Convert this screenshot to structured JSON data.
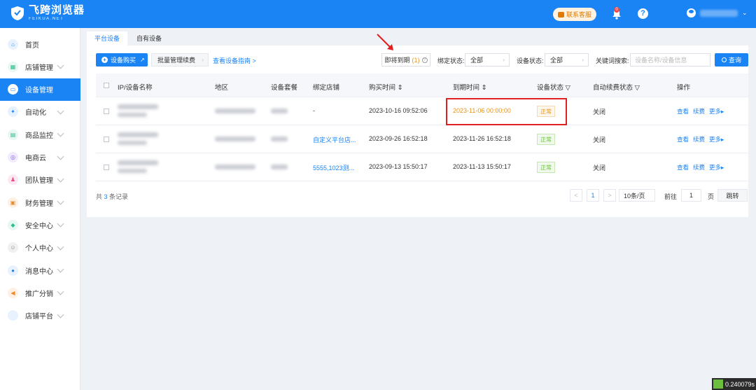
{
  "app": {
    "name_cn": "飞跨浏览器",
    "name_en": "FEIKUA.NET"
  },
  "topbar": {
    "contact": "联系客服",
    "notif_count": "0",
    "help": "?"
  },
  "sidebar": {
    "items": [
      {
        "label": "首页",
        "icon": "home-icon",
        "color": "#1b84f5",
        "bg": "#e8f2fe",
        "glyph": "⌂"
      },
      {
        "label": "店铺管理",
        "icon": "store-icon",
        "color": "#2dbf8a",
        "bg": "#e6f8f1",
        "glyph": "▦"
      },
      {
        "label": "设备管理",
        "icon": "device-icon",
        "color": "#1b84f5",
        "bg": "#ffffff",
        "glyph": "▭"
      },
      {
        "label": "自动化",
        "icon": "automation-icon",
        "color": "#1b84f5",
        "bg": "#e8f2fe",
        "glyph": "✦"
      },
      {
        "label": "商品监控",
        "icon": "monitor-icon",
        "color": "#2dbf8a",
        "bg": "#e6f8f1",
        "glyph": "▤"
      },
      {
        "label": "电商云",
        "icon": "cloud-icon",
        "color": "#8a5cf5",
        "bg": "#f0eafe",
        "glyph": "◎"
      },
      {
        "label": "团队管理",
        "icon": "team-icon",
        "color": "#e84a8a",
        "bg": "#fde9f1",
        "glyph": "♟"
      },
      {
        "label": "财务管理",
        "icon": "finance-icon",
        "color": "#f08a24",
        "bg": "#fef1e3",
        "glyph": "▣"
      },
      {
        "label": "安全中心",
        "icon": "shield-icon",
        "color": "#2dbf8a",
        "bg": "#e6f8f1",
        "glyph": "◆"
      },
      {
        "label": "个人中心",
        "icon": "user-icon",
        "color": "#888888",
        "bg": "#f0f0f0",
        "glyph": "☺"
      },
      {
        "label": "消息中心",
        "icon": "message-icon",
        "color": "#1b84f5",
        "bg": "#e8f2fe",
        "glyph": "●"
      },
      {
        "label": "推广分销",
        "icon": "promote-icon",
        "color": "#f08a24",
        "bg": "#fef1e3",
        "glyph": "◀"
      },
      {
        "label": "店铺平台",
        "icon": "platform-icon",
        "color": "#1b84f5",
        "bg": "#e8f2fe",
        "glyph": ""
      }
    ]
  },
  "tabs": [
    "平台设备",
    "自有设备"
  ],
  "toolbar": {
    "buy": "设备购买",
    "batch": "批量管理续费",
    "guide": "查看设备指南 >",
    "expiring": "即将到期",
    "expiring_count": "(1)",
    "bind_label": "绑定状态:",
    "bind_value": "全部",
    "status_label": "设备状态:",
    "status_value": "全部",
    "keyword_label": "关键词搜索:",
    "keyword_placeholder": "设备名称/设备信息",
    "query": "查询"
  },
  "table": {
    "headers": [
      "IP/设备名称",
      "地区",
      "设备套餐",
      "绑定店铺",
      "购买时间 ⇕",
      "到期时间 ⇕",
      "设备状态 ▽",
      "自动续费状态 ▽",
      "操作"
    ],
    "rows": [
      {
        "shop": "-",
        "buy": "2023-10-16 09:52:06",
        "expire": "2023-11-06 00:00:00",
        "status": "正常",
        "auto": "关闭",
        "ops": [
          "查看",
          "续费",
          "更多▸"
        ]
      },
      {
        "shop": "自定义平台店...",
        "buy": "2023-09-26 16:52:18",
        "expire": "2023-11-26 16:52:18",
        "status": "正常",
        "auto": "关闭",
        "ops": [
          "查看",
          "续费",
          "更多▸"
        ]
      },
      {
        "shop": "5555,1023测...",
        "buy": "2023-09-13 15:50:17",
        "expire": "2023-11-13 15:50:17",
        "status": "正常",
        "auto": "关闭",
        "ops": [
          "查看",
          "续费",
          "更多▸"
        ]
      }
    ]
  },
  "footer": {
    "total_prefix": "共 ",
    "total_count": "3",
    "total_suffix": " 条记录",
    "prev": "<",
    "page": "1",
    "next": ">",
    "page_size": "10条/页",
    "goto": "前往",
    "goto_value": "1",
    "page_unit": "页",
    "jump": "跳转"
  },
  "corner_badge": "0.240079s",
  "colors": {
    "primary": "#1b84f5",
    "warning": "#e89318",
    "success": "#67c23a",
    "highlight": "#e02020"
  }
}
